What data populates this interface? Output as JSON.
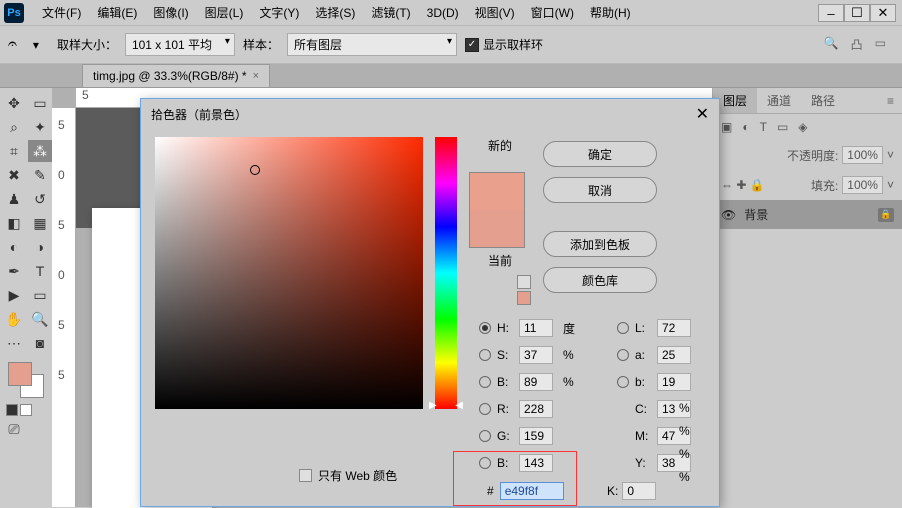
{
  "app": {
    "logo": "Ps"
  },
  "menu": [
    "文件(F)",
    "编辑(E)",
    "图像(I)",
    "图层(L)",
    "文字(Y)",
    "选择(S)",
    "滤镜(T)",
    "3D(D)",
    "视图(V)",
    "窗口(W)",
    "帮助(H)"
  ],
  "window_buttons": {
    "min": "–",
    "max": "☐",
    "close": "✕"
  },
  "options": {
    "sample_size_label": "取样大小：",
    "sample_size_value": "101 x 101 平均",
    "sample_label": "样本：",
    "sample_value": "所有图层",
    "show_ring": "显示取样环"
  },
  "doc_tab": {
    "title": "timg.jpg @ 33.3%(RGB/8#) *",
    "close": "×"
  },
  "ruler": {
    "h": [
      "5"
    ],
    "v": [
      "5",
      "0",
      "5",
      "0",
      "5",
      "5"
    ]
  },
  "panels": {
    "tabs": [
      "图层",
      "通道",
      "路径"
    ],
    "opacity_label": "不透明度:",
    "opacity_value": "100%",
    "fill_label": "填充:",
    "fill_value": "100%",
    "lock_icons": "⇔ ✚ 🔒",
    "layer_name": "背景"
  },
  "picker": {
    "title": "拾色器（前景色）",
    "close": "✕",
    "new_label": "新的",
    "current_label": "当前",
    "btn_ok": "确定",
    "btn_cancel": "取消",
    "btn_add": "添加到色板",
    "btn_lib": "颜色库",
    "web_only": "只有 Web 颜色",
    "H": {
      "label": "H:",
      "value": "11",
      "unit": "度"
    },
    "S": {
      "label": "S:",
      "value": "37",
      "unit": "%"
    },
    "Bv": {
      "label": "B:",
      "value": "89",
      "unit": "%"
    },
    "L": {
      "label": "L:",
      "value": "72"
    },
    "a": {
      "label": "a:",
      "value": "25"
    },
    "b": {
      "label": "b:",
      "value": "19"
    },
    "R": {
      "label": "R:",
      "value": "228"
    },
    "G": {
      "label": "G:",
      "value": "159"
    },
    "Bc": {
      "label": "B:",
      "value": "143"
    },
    "C": {
      "label": "C:",
      "value": "13",
      "unit": "%"
    },
    "M": {
      "label": "M:",
      "value": "47",
      "unit": "%"
    },
    "Y": {
      "label": "Y:",
      "value": "38",
      "unit": "%"
    },
    "K": {
      "label": "K:",
      "value": "0",
      "unit": "%"
    },
    "hex_label": "#",
    "hex_value": "e49f8f"
  },
  "colors": {
    "fg": "#e49f8f",
    "bg": "#ffffff",
    "new": "#e9a18e"
  }
}
